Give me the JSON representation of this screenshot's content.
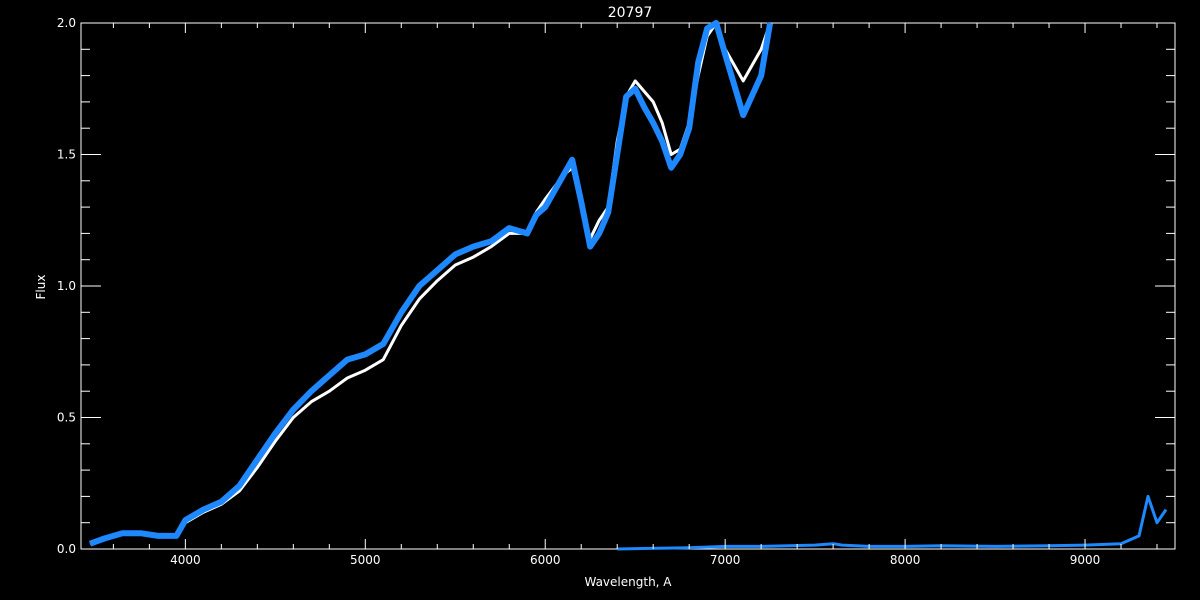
{
  "chart_data": {
    "type": "line",
    "title": "20797",
    "xlabel": "Wavelength, A",
    "ylabel": "Flux",
    "xlim": [
      3420,
      9500
    ],
    "ylim": [
      0,
      2.0
    ],
    "xticks": [
      4000,
      5000,
      6000,
      7000,
      8000,
      9000
    ],
    "xtick_labels": [
      "4000",
      "5000",
      "6000",
      "7000",
      "8000",
      "9000"
    ],
    "yticks": [
      0,
      0.5,
      1.0,
      1.5,
      2.0
    ],
    "ytick_labels": [
      "0.0",
      "0.5",
      "1.0",
      "1.5",
      "2.0"
    ],
    "grid": false,
    "background": "#000000",
    "axis_color": "#ffffff",
    "series": [
      {
        "color": "#ffffff",
        "x": [
          3470,
          3550,
          3650,
          3750,
          3850,
          3950,
          4000,
          4100,
          4200,
          4300,
          4400,
          4500,
          4600,
          4700,
          4800,
          4900,
          5000,
          5100,
          5200,
          5300,
          5400,
          5500,
          5600,
          5700,
          5800,
          5900,
          5950,
          6000,
          6100,
          6150,
          6200,
          6250,
          6300,
          6350,
          6400,
          6450,
          6500,
          6550,
          6600,
          6650,
          6700,
          6750,
          6800,
          6850,
          6900,
          6950,
          7000,
          7100,
          7200,
          7250
        ],
        "y": [
          0.02,
          0.04,
          0.06,
          0.06,
          0.05,
          0.05,
          0.1,
          0.14,
          0.17,
          0.22,
          0.31,
          0.41,
          0.5,
          0.56,
          0.6,
          0.65,
          0.68,
          0.72,
          0.85,
          0.95,
          1.02,
          1.08,
          1.11,
          1.15,
          1.2,
          1.2,
          1.28,
          1.33,
          1.42,
          1.45,
          1.3,
          1.18,
          1.25,
          1.3,
          1.55,
          1.72,
          1.78,
          1.74,
          1.7,
          1.62,
          1.5,
          1.52,
          1.62,
          1.8,
          1.95,
          2.0,
          1.9,
          1.78,
          1.9,
          2.0
        ]
      },
      {
        "color": "#1e88ff",
        "x": [
          3470,
          3550,
          3650,
          3750,
          3850,
          3950,
          4000,
          4100,
          4200,
          4300,
          4400,
          4500,
          4600,
          4700,
          4800,
          4900,
          5000,
          5100,
          5200,
          5300,
          5400,
          5500,
          5600,
          5700,
          5800,
          5900,
          5950,
          6000,
          6100,
          6150,
          6200,
          6250,
          6300,
          6350,
          6400,
          6450,
          6500,
          6550,
          6600,
          6650,
          6700,
          6750,
          6800,
          6850,
          6900,
          6950,
          7000,
          7100,
          7200,
          7250
        ],
        "y": [
          0.02,
          0.04,
          0.06,
          0.06,
          0.05,
          0.05,
          0.11,
          0.15,
          0.18,
          0.24,
          0.34,
          0.44,
          0.53,
          0.6,
          0.66,
          0.72,
          0.74,
          0.78,
          0.9,
          1.0,
          1.06,
          1.12,
          1.15,
          1.17,
          1.22,
          1.2,
          1.27,
          1.3,
          1.42,
          1.48,
          1.32,
          1.15,
          1.2,
          1.28,
          1.5,
          1.72,
          1.75,
          1.68,
          1.62,
          1.55,
          1.45,
          1.5,
          1.6,
          1.85,
          1.98,
          2.0,
          1.88,
          1.65,
          1.8,
          2.0
        ]
      },
      {
        "color": "#1e88ff",
        "x": [
          6400,
          6800,
          7000,
          7200,
          7500,
          7600,
          7650,
          7800,
          8000,
          8200,
          8500,
          8800,
          9000,
          9200,
          9300,
          9350,
          9400,
          9450
        ],
        "y": [
          0.0,
          0.005,
          0.01,
          0.01,
          0.015,
          0.02,
          0.015,
          0.01,
          0.01,
          0.012,
          0.01,
          0.012,
          0.015,
          0.02,
          0.05,
          0.2,
          0.1,
          0.15
        ]
      }
    ]
  }
}
